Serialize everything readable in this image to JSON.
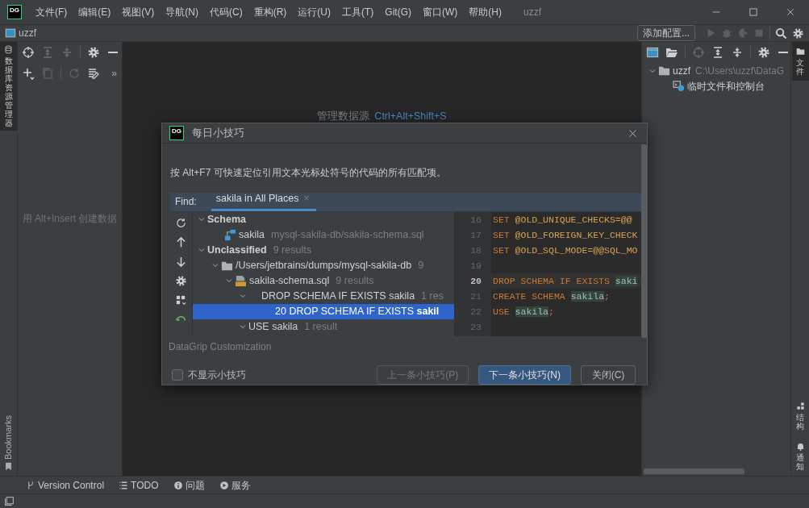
{
  "title_bar": {
    "logo": "DG",
    "menus": [
      "文件(F)",
      "编辑(E)",
      "视图(V)",
      "导航(N)",
      "代码(C)",
      "重构(R)",
      "运行(U)",
      "工具(T)",
      "Git(G)",
      "窗口(W)",
      "帮助(H)"
    ],
    "title": "uzzf"
  },
  "toolbar": {
    "project": "uzzf",
    "add_config": "添加配置..."
  },
  "left_strip": {
    "top_tab": "数据库资源管理器",
    "bottom_tab": "Bookmarks"
  },
  "left_panel": {
    "more": "»",
    "empty_hint": "用 Alt+Insert 创建数据"
  },
  "editor": {
    "hint_label": "管理数据源",
    "hint_shortcut": "Ctrl+Alt+Shift+S"
  },
  "right_panel": {
    "tree": [
      {
        "label": "uzzf",
        "path": "C:\\Users\\uzzf\\DataG",
        "expanded": true,
        "children": [
          {
            "label": "临时文件和控制台"
          }
        ]
      }
    ]
  },
  "right_strip": {
    "tabs": [
      "文件",
      "结构",
      "通知"
    ]
  },
  "bottom_tools": [
    "Version Control",
    "TODO",
    "问题",
    "服务"
  ],
  "dialog": {
    "logo": "DG",
    "title": "每日小技巧",
    "tip": "按 Alt+F7 可快速定位引用文本光标处符号的代码的所有匹配项。",
    "tip_image": {
      "find_label": "Find:",
      "tab": {
        "label": "sakila in All Places",
        "close": "×",
        "selected": true
      },
      "results": [
        {
          "kind": "group",
          "label": "Schema",
          "expanded": true,
          "selected": false,
          "children": [
            {
              "kind": "schema",
              "label": "sakila",
              "detail": "mysql-sakila-db/sakila-schema.sql",
              "selected": false
            }
          ]
        },
        {
          "kind": "group",
          "label": "Unclassified",
          "detail": "9 results",
          "expanded": true,
          "selected": false,
          "children": [
            {
              "kind": "folder",
              "label": "/Users/jetbrains/dumps/mysql-sakila-db",
              "detail": "9",
              "expanded": true,
              "selected": false,
              "children": [
                {
                  "kind": "sqlfile",
                  "label": "sakila-schema.sql",
                  "detail": "9 results",
                  "expanded": true,
                  "selected": false,
                  "children": [
                    {
                      "kind": "statement",
                      "label": "DROP SCHEMA IF EXISTS sakila",
                      "detail": "1 res",
                      "expanded": true,
                      "selected": false,
                      "children": [
                        {
                          "kind": "occurrence",
                          "label": "20 DROP SCHEMA IF EXISTS **sakil**",
                          "selected": true
                        }
                      ]
                    },
                    {
                      "kind": "usage",
                      "label": "USE sakila",
                      "detail": "1 result",
                      "expanded": true,
                      "selected": false
                    }
                  ]
                }
              ]
            }
          ]
        }
      ],
      "lines": [
        {
          "number": "16",
          "current": false,
          "tokens": [
            {
              "kind": "keyword",
              "text": "SET "
            },
            {
              "kind": "variable",
              "text": "@OLD_UNIQUE_CHECKS=@@"
            }
          ]
        },
        {
          "number": "17",
          "current": false,
          "tokens": [
            {
              "kind": "keyword",
              "text": "SET "
            },
            {
              "kind": "variable",
              "text": "@OLD_FOREIGN_KEY_CHECK"
            }
          ]
        },
        {
          "number": "18",
          "current": false,
          "tokens": [
            {
              "kind": "keyword",
              "text": "SET "
            },
            {
              "kind": "variable",
              "text": "@OLD_SQL_MODE=@@SQL_MO"
            }
          ]
        },
        {
          "number": "19",
          "current": false
        },
        {
          "number": "20",
          "current": true,
          "tokens": [
            {
              "kind": "keyword",
              "text": "DROP SCHEMA IF EXISTS "
            },
            {
              "kind": "match",
              "text": "saki"
            }
          ]
        },
        {
          "number": "21",
          "current": false,
          "tokens": [
            {
              "kind": "keyword",
              "text": "CREATE SCHEMA "
            },
            {
              "kind": "match",
              "text": "sakila"
            },
            {
              "kind": "keyword",
              "text": ";"
            }
          ]
        },
        {
          "number": "22",
          "current": false,
          "tokens": [
            {
              "kind": "keyword",
              "text": "USE "
            },
            {
              "kind": "match",
              "text": "sakila"
            },
            {
              "kind": "keyword",
              "text": ";"
            }
          ]
        },
        {
          "number": "23",
          "current": false
        }
      ]
    },
    "source": "DataGrip Customization",
    "dont_show": {
      "label": "不显示小技巧",
      "checked": false
    },
    "buttons": [
      {
        "label": "上一条小技巧(P)",
        "kind": "secondary",
        "disabled": true
      },
      {
        "label": "下一条小技巧(N)",
        "kind": "primary",
        "disabled": false
      },
      {
        "label": "关闭(C)",
        "kind": "secondary",
        "disabled": false
      }
    ]
  }
}
